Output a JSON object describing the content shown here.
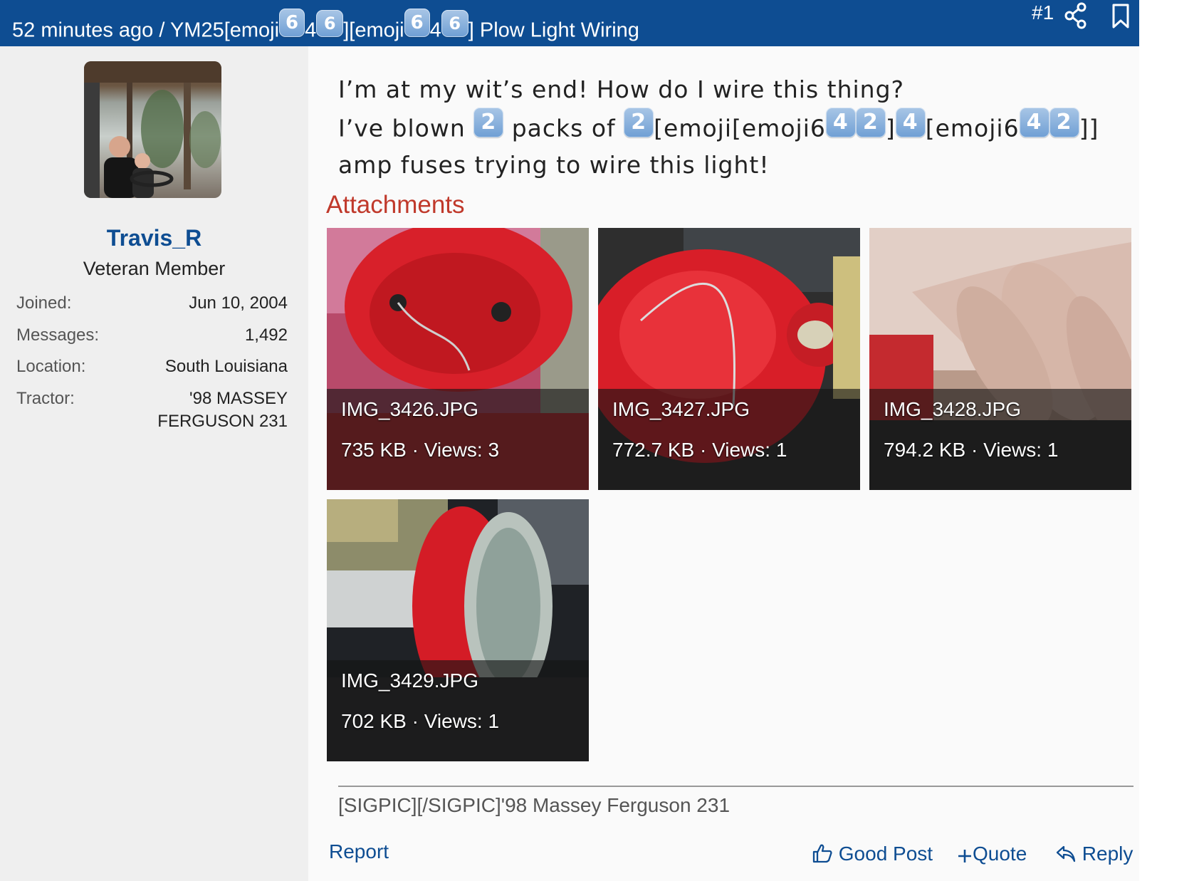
{
  "colors": {
    "header_bg": "#0e4d92",
    "link": "#0e4d92",
    "attachments_heading": "#c0392b"
  },
  "header": {
    "breadcrumb_parts": {
      "time_and_prefix": "52 minutes ago / YM25[emoji",
      "key_a": "6",
      "digit_4a": "4",
      "key_b": "6",
      "mid": "][emoji",
      "key_c": "6",
      "digit_4b": "4",
      "key_d": "6",
      "suffix": "] Plow Light Wiring"
    },
    "post_number": "#1",
    "share_icon": "share-icon",
    "bookmark_icon": "bookmark-icon"
  },
  "author": {
    "avatar_icon": "avatar",
    "username": "Travis_R",
    "title": "Veteran Member",
    "stats": [
      {
        "label": "Joined:",
        "value": "Jun 10, 2004"
      },
      {
        "label": "Messages:",
        "value": "1,492"
      },
      {
        "label": "Location:",
        "value": "South Louisiana"
      },
      {
        "label": "Tractor:",
        "value_line1": "'98 MASSEY",
        "value_line2": "FERGUSON 231"
      }
    ]
  },
  "post": {
    "line1": "I’m at my wit’s end! How do I wire this thing?",
    "line2": {
      "t1": "I’ve blown ",
      "k1": "2",
      "t2": " packs of ",
      "k2": "2",
      "t3": "[emoji[emoji6",
      "k3": "4",
      "k4": "2",
      "t4": "]",
      "k5": "4",
      "t5": "[emoji6",
      "k6": "4",
      "k7": "2",
      "t6": "]]"
    },
    "line3": "amp fuses trying to wire this light!"
  },
  "attachments": {
    "heading": "Attachments",
    "items": [
      {
        "filename": "IMG_3426.JPG",
        "size": "735 KB",
        "sep": " · ",
        "views": "Views: 3"
      },
      {
        "filename": "IMG_3427.JPG",
        "size": "772.7 KB",
        "sep": " · ",
        "views": "Views: 1"
      },
      {
        "filename": "IMG_3428.JPG",
        "size": "794.2 KB",
        "sep": " · ",
        "views": "Views: 1"
      },
      {
        "filename": "IMG_3429.JPG",
        "size": "702 KB",
        "sep": " · ",
        "views": "Views: 1"
      }
    ]
  },
  "signature": "[SIGPIC][/SIGPIC]'98 Massey Ferguson 231",
  "footer": {
    "report": "Report",
    "good_post": "Good Post",
    "quote": "Quote",
    "reply": "Reply"
  }
}
